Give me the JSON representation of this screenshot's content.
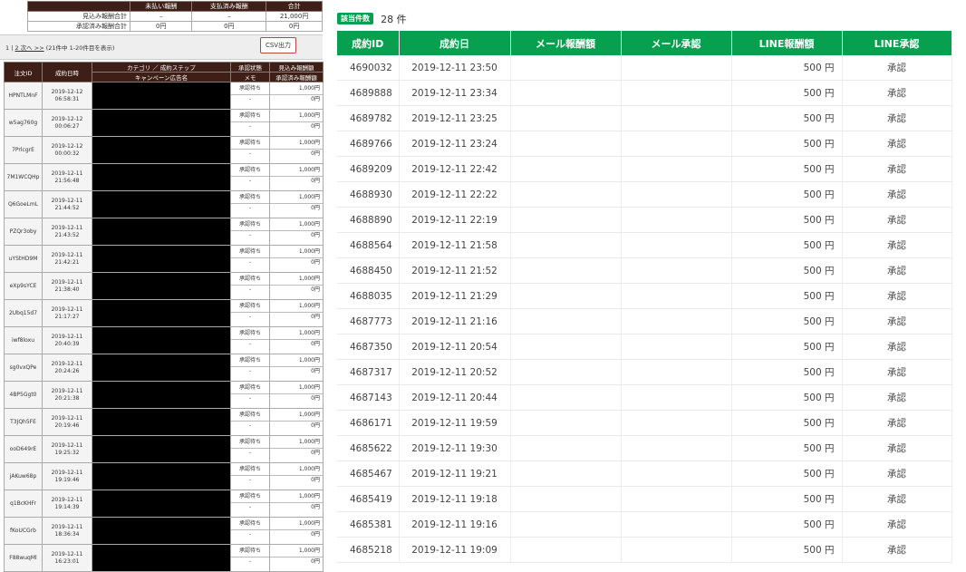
{
  "left": {
    "summary": {
      "headers": [
        "未払い報酬",
        "支払済み報酬",
        "合計"
      ],
      "rows": [
        {
          "label": "見込み報酬合計",
          "unpaid": "–",
          "paid": "–",
          "total": "21,000円"
        },
        {
          "label": "承認済み報酬合計",
          "unpaid": "0円",
          "paid": "0円",
          "total": "0円"
        }
      ]
    },
    "pagination": {
      "prefix": "1 |",
      "next_link": "2 次へ >>",
      "info": "(21件中 1-20件目を表示)",
      "csv_label": "CSV出力"
    },
    "table": {
      "headers": {
        "order_id": "注文ID",
        "date": "成約日時",
        "category": "カテゴリ ／ 成約ステップ",
        "campaign": "キャンペーン広告名",
        "status": "承認状態",
        "memo": "メモ",
        "expected": "見込み報酬額",
        "approved": "承認済み報酬額"
      },
      "rows": [
        {
          "id": "HPNTLMnF",
          "date": "2019-12-12",
          "time": "06:58:31",
          "status": "承認待ち",
          "memo": "-",
          "expected": "1,000円",
          "approved": "0円"
        },
        {
          "id": "w5ag760g",
          "date": "2019-12-12",
          "time": "00:06:27",
          "status": "承認待ち",
          "memo": "-",
          "expected": "1,000円",
          "approved": "0円"
        },
        {
          "id": "7PrlcgrE",
          "date": "2019-12-12",
          "time": "00:00:32",
          "status": "承認待ち",
          "memo": "-",
          "expected": "1,000円",
          "approved": "0円"
        },
        {
          "id": "7M1WCQHp",
          "date": "2019-12-11",
          "time": "21:56:48",
          "status": "承認待ち",
          "memo": "-",
          "expected": "1,000円",
          "approved": "0円"
        },
        {
          "id": "Q6GoeLmL",
          "date": "2019-12-11",
          "time": "21:44:52",
          "status": "承認待ち",
          "memo": "-",
          "expected": "1,000円",
          "approved": "0円"
        },
        {
          "id": "PZQr3oby",
          "date": "2019-12-11",
          "time": "21:43:52",
          "status": "承認待ち",
          "memo": "-",
          "expected": "1,000円",
          "approved": "0円"
        },
        {
          "id": "uYStHD9M",
          "date": "2019-12-11",
          "time": "21:42:21",
          "status": "承認待ち",
          "memo": "-",
          "expected": "1,000円",
          "approved": "0円"
        },
        {
          "id": "eXp9sYCE",
          "date": "2019-12-11",
          "time": "21:38:40",
          "status": "承認待ち",
          "memo": "-",
          "expected": "1,000円",
          "approved": "0円"
        },
        {
          "id": "2Ubq15d7",
          "date": "2019-12-11",
          "time": "21:17:27",
          "status": "承認待ち",
          "memo": "-",
          "expected": "1,000円",
          "approved": "0円"
        },
        {
          "id": "iwf8loxu",
          "date": "2019-12-11",
          "time": "20:40:39",
          "status": "承認待ち",
          "memo": "-",
          "expected": "1,000円",
          "approved": "0円"
        },
        {
          "id": "sg0vxQPe",
          "date": "2019-12-11",
          "time": "20:24:26",
          "status": "承認待ち",
          "memo": "-",
          "expected": "1,000円",
          "approved": "0円"
        },
        {
          "id": "4BP5Ggt0",
          "date": "2019-12-11",
          "time": "20:21:38",
          "status": "承認待ち",
          "memo": "-",
          "expected": "1,000円",
          "approved": "0円"
        },
        {
          "id": "T3JQh5FE",
          "date": "2019-12-11",
          "time": "20:19:46",
          "status": "承認待ち",
          "memo": "-",
          "expected": "1,000円",
          "approved": "0円"
        },
        {
          "id": "ooD649rE",
          "date": "2019-12-11",
          "time": "19:25:32",
          "status": "承認待ち",
          "memo": "-",
          "expected": "1,000円",
          "approved": "0円"
        },
        {
          "id": "jAKuw68p",
          "date": "2019-12-11",
          "time": "19:19:46",
          "status": "承認待ち",
          "memo": "-",
          "expected": "1,000円",
          "approved": "0円"
        },
        {
          "id": "q1BcKHFr",
          "date": "2019-12-11",
          "time": "19:14:39",
          "status": "承認待ち",
          "memo": "-",
          "expected": "1,000円",
          "approved": "0円"
        },
        {
          "id": "fKoUCGrb",
          "date": "2019-12-11",
          "time": "18:36:34",
          "status": "承認待ち",
          "memo": "-",
          "expected": "1,000円",
          "approved": "0円"
        },
        {
          "id": "F88wuqMl",
          "date": "2019-12-11",
          "time": "16:23:01",
          "status": "承認待ち",
          "memo": "-",
          "expected": "1,000円",
          "approved": "0円"
        }
      ]
    }
  },
  "right": {
    "badge": "該当件数",
    "count": "28 件",
    "headers": [
      "成約ID",
      "成約日",
      "メール報酬額",
      "メール承認",
      "LINE報酬額",
      "LINE承認"
    ],
    "rows": [
      {
        "id": "4690032",
        "date": "2019-12-11 23:50",
        "mail_amount": "",
        "mail_status": "",
        "line_amount": "500 円",
        "line_status": "承認"
      },
      {
        "id": "4689888",
        "date": "2019-12-11 23:34",
        "mail_amount": "",
        "mail_status": "",
        "line_amount": "500 円",
        "line_status": "承認"
      },
      {
        "id": "4689782",
        "date": "2019-12-11 23:25",
        "mail_amount": "",
        "mail_status": "",
        "line_amount": "500 円",
        "line_status": "承認"
      },
      {
        "id": "4689766",
        "date": "2019-12-11 23:24",
        "mail_amount": "",
        "mail_status": "",
        "line_amount": "500 円",
        "line_status": "承認"
      },
      {
        "id": "4689209",
        "date": "2019-12-11 22:42",
        "mail_amount": "",
        "mail_status": "",
        "line_amount": "500 円",
        "line_status": "承認"
      },
      {
        "id": "4688930",
        "date": "2019-12-11 22:22",
        "mail_amount": "",
        "mail_status": "",
        "line_amount": "500 円",
        "line_status": "承認"
      },
      {
        "id": "4688890",
        "date": "2019-12-11 22:19",
        "mail_amount": "",
        "mail_status": "",
        "line_amount": "500 円",
        "line_status": "承認"
      },
      {
        "id": "4688564",
        "date": "2019-12-11 21:58",
        "mail_amount": "",
        "mail_status": "",
        "line_amount": "500 円",
        "line_status": "承認"
      },
      {
        "id": "4688450",
        "date": "2019-12-11 21:52",
        "mail_amount": "",
        "mail_status": "",
        "line_amount": "500 円",
        "line_status": "承認"
      },
      {
        "id": "4688035",
        "date": "2019-12-11 21:29",
        "mail_amount": "",
        "mail_status": "",
        "line_amount": "500 円",
        "line_status": "承認"
      },
      {
        "id": "4687773",
        "date": "2019-12-11 21:16",
        "mail_amount": "",
        "mail_status": "",
        "line_amount": "500 円",
        "line_status": "承認"
      },
      {
        "id": "4687350",
        "date": "2019-12-11 20:54",
        "mail_amount": "",
        "mail_status": "",
        "line_amount": "500 円",
        "line_status": "承認"
      },
      {
        "id": "4687317",
        "date": "2019-12-11 20:52",
        "mail_amount": "",
        "mail_status": "",
        "line_amount": "500 円",
        "line_status": "承認"
      },
      {
        "id": "4687143",
        "date": "2019-12-11 20:44",
        "mail_amount": "",
        "mail_status": "",
        "line_amount": "500 円",
        "line_status": "承認"
      },
      {
        "id": "4686171",
        "date": "2019-12-11 19:59",
        "mail_amount": "",
        "mail_status": "",
        "line_amount": "500 円",
        "line_status": "承認"
      },
      {
        "id": "4685622",
        "date": "2019-12-11 19:30",
        "mail_amount": "",
        "mail_status": "",
        "line_amount": "500 円",
        "line_status": "承認"
      },
      {
        "id": "4685467",
        "date": "2019-12-11 19:21",
        "mail_amount": "",
        "mail_status": "",
        "line_amount": "500 円",
        "line_status": "承認"
      },
      {
        "id": "4685419",
        "date": "2019-12-11 19:18",
        "mail_amount": "",
        "mail_status": "",
        "line_amount": "500 円",
        "line_status": "承認"
      },
      {
        "id": "4685381",
        "date": "2019-12-11 19:16",
        "mail_amount": "",
        "mail_status": "",
        "line_amount": "500 円",
        "line_status": "承認"
      },
      {
        "id": "4685218",
        "date": "2019-12-11 19:09",
        "mail_amount": "",
        "mail_status": "",
        "line_amount": "500 円",
        "line_status": "承認"
      }
    ]
  },
  "colors": {
    "dark_header": "#3e1f17",
    "green_header": "#07a04f",
    "redacted": "#000000"
  }
}
